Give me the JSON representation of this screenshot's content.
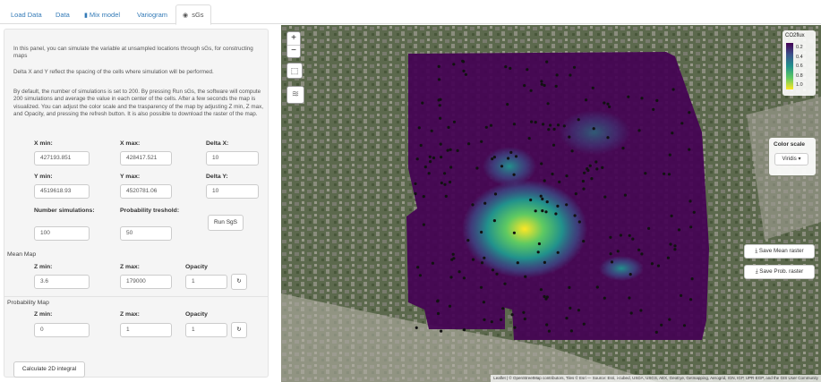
{
  "tabs": [
    {
      "label": "Load Data",
      "icon": ""
    },
    {
      "label": "Data",
      "icon": ""
    },
    {
      "label": "Mix model",
      "icon": "bar-chart-icon"
    },
    {
      "label": "Variogram",
      "icon": ""
    },
    {
      "label": "sGs",
      "icon": "globe-icon"
    }
  ],
  "panel": {
    "intro": "In this panel, you can simulate the variable at unsampled locations through sGs, for constructing maps",
    "delta_info": "Delta X and Y reflect the spacing of the cells where simulation will be performed.",
    "default_info": "By default, the number of simulations is set to 200. By pressing Run sGs, the software will compute 200 simulations and average the value in each center of the cells. After a few seconds the map is visualized. You can adjust the color scale and the trasparency of the map by adjusting Z min, Z max, and Opacity, and pressing the refresh button. It is also possible to download the raster of the map.",
    "x_min_label": "X min:",
    "x_min": "427193.851",
    "x_max_label": "X max:",
    "x_max": "428417.521",
    "delta_x_label": "Delta X:",
    "delta_x": "10",
    "y_min_label": "Y min:",
    "y_min": "4519618.93",
    "y_max_label": "Y max:",
    "y_max": "4520781.06",
    "delta_y_label": "Delta Y:",
    "delta_y": "10",
    "nsim_label": "Number simulations:",
    "nsim": "100",
    "prob_label": "Probability treshold:",
    "prob": "50",
    "run_button": "Run SgS",
    "mean_map_title": "Mean Map",
    "mean_zmin_label": "Z min:",
    "mean_zmin": "3.6",
    "mean_zmax_label": "Z max:",
    "mean_zmax": "179000",
    "mean_opacity_label": "Opacity",
    "mean_opacity": "1",
    "prob_map_title": "Probability Map",
    "prob_zmin_label": "Z min:",
    "prob_zmin": "0",
    "prob_zmax_label": "Z max:",
    "prob_zmax": "1",
    "prob_opacity_label": "Opacity",
    "prob_opacity": "1",
    "calc_button": "Calculate 2D integral"
  },
  "map": {
    "zoom_in": "+",
    "zoom_out": "−",
    "legend_title": "CO2flux",
    "legend_ticks": [
      "0.2",
      "0.4",
      "0.6",
      "0.8",
      "1.0"
    ],
    "color_scale_label": "Color scale",
    "color_scale_value": "Viridis",
    "save_mean": "Save Mean raster",
    "save_prob": "Save Prob. raster",
    "attribution": "Leaflet | © OpenStreetMap contributors, Tiles © Esri — Source: Esri, i-cubed, USDA, USGS, AEX, GeoEye, Getmapping, Aerogrid, IGN, IGP, UPR-EGP, and the GIS User Community",
    "viridis": [
      "#440154",
      "#3b528b",
      "#21918c",
      "#5ec962",
      "#fde725"
    ]
  }
}
